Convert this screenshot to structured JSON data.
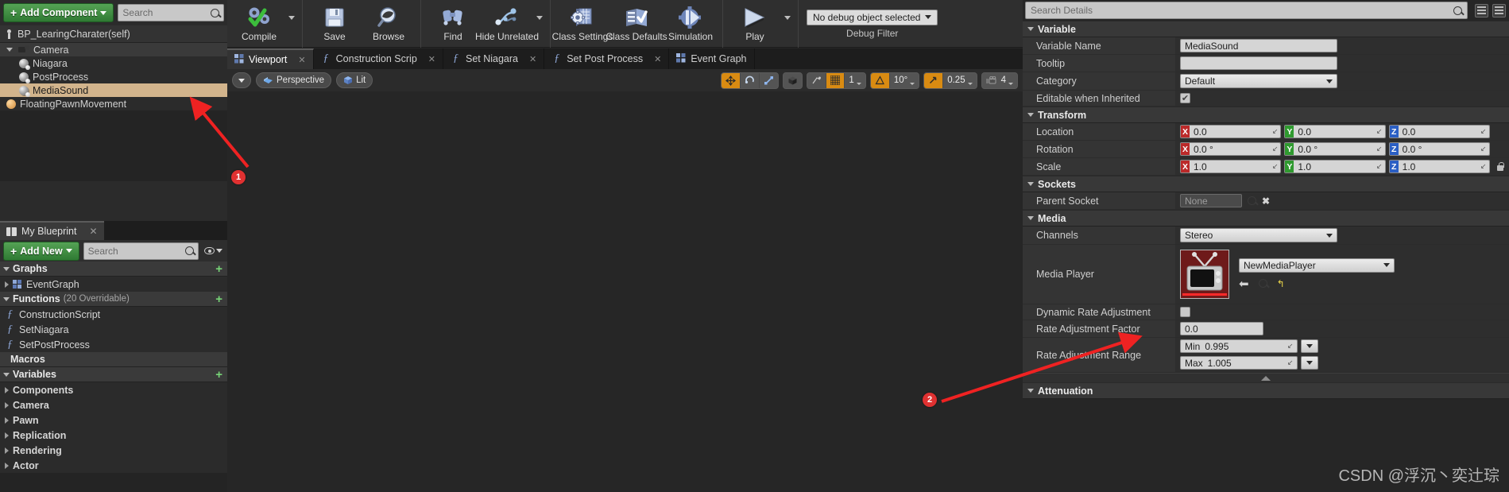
{
  "components_panel": {
    "add_component_label": "Add Component",
    "search_placeholder": "Search",
    "root_label": "BP_LearingCharater(self)",
    "items": [
      {
        "label": "Camera",
        "indent": 0,
        "icon": "camera-icon",
        "selected": false
      },
      {
        "label": "Niagara",
        "indent": 1,
        "icon": "sphere-icon",
        "selected": false
      },
      {
        "label": "PostProcess",
        "indent": 1,
        "icon": "sphere-icon",
        "selected": false
      },
      {
        "label": "MediaSound",
        "indent": 1,
        "icon": "sphere-icon",
        "selected": true
      },
      {
        "label": "FloatingPawnMovement",
        "indent": 0,
        "icon": "movement-icon",
        "selected": false
      }
    ]
  },
  "my_blueprint": {
    "tab_label": "My Blueprint",
    "add_new_label": "Add New",
    "search_placeholder": "Search",
    "sections": [
      {
        "title": "Graphs",
        "sub": "",
        "expanded": true,
        "items": [
          {
            "label": "EventGraph",
            "icon": "graph-icon",
            "expandable": true
          }
        ]
      },
      {
        "title": "Functions",
        "sub": "(20 Overridable)",
        "expanded": true,
        "items": [
          {
            "label": "ConstructionScript",
            "icon": "function-icon",
            "expandable": false
          },
          {
            "label": "SetNiagara",
            "icon": "function-icon",
            "expandable": false
          },
          {
            "label": "SetPostProcess",
            "icon": "function-icon",
            "expandable": false
          }
        ]
      },
      {
        "title": "Macros",
        "sub": "",
        "expanded": false,
        "items": []
      },
      {
        "title": "Variables",
        "sub": "",
        "expanded": true,
        "items": [
          {
            "label": "Components",
            "icon": "",
            "expandable": true
          },
          {
            "label": "Camera",
            "icon": "",
            "expandable": true
          },
          {
            "label": "Pawn",
            "icon": "",
            "expandable": true
          },
          {
            "label": "Replication",
            "icon": "",
            "expandable": true
          },
          {
            "label": "Rendering",
            "icon": "",
            "expandable": true
          },
          {
            "label": "Actor",
            "icon": "",
            "expandable": true
          }
        ]
      }
    ]
  },
  "toolbar": {
    "buttons": [
      {
        "label": "Compile",
        "icon": "compile-icon",
        "has_dropdown": true
      },
      {
        "label": "Save",
        "icon": "save-icon",
        "has_dropdown": false
      },
      {
        "label": "Browse",
        "icon": "browse-icon",
        "has_dropdown": false
      },
      {
        "label": "Find",
        "icon": "find-icon",
        "has_dropdown": false
      },
      {
        "label": "Hide Unrelated",
        "icon": "hide-unrelated-icon",
        "has_dropdown": true
      },
      {
        "label": "Class Settings",
        "icon": "class-settings-icon",
        "has_dropdown": false
      },
      {
        "label": "Class Defaults",
        "icon": "class-defaults-icon",
        "has_dropdown": false
      },
      {
        "label": "Simulation",
        "icon": "simulation-icon",
        "has_dropdown": false
      },
      {
        "label": "Play",
        "icon": "play-icon",
        "has_dropdown": true
      }
    ],
    "debug_selected": "No debug object selected",
    "debug_filter_label": "Debug Filter"
  },
  "graph_tabs": [
    {
      "label": "Viewport",
      "icon": "viewport-icon",
      "active": true,
      "closable": true
    },
    {
      "label": "Construction Scrip",
      "icon": "function-icon",
      "active": false,
      "closable": true
    },
    {
      "label": "Set Niagara",
      "icon": "function-icon",
      "active": false,
      "closable": true
    },
    {
      "label": "Set Post Process",
      "icon": "function-icon",
      "active": false,
      "closable": true
    },
    {
      "label": "Event Graph",
      "icon": "graph-icon",
      "active": false,
      "closable": false
    }
  ],
  "viewport": {
    "perspective_label": "Perspective",
    "lit_label": "Lit",
    "grid_snap_value": "1",
    "angle_snap_value": "10°",
    "scale_snap_value": "0.25",
    "camera_speed_value": "4"
  },
  "details": {
    "search_placeholder": "Search Details",
    "categories": [
      {
        "title": "Variable",
        "rows": [
          {
            "name": "Variable Name",
            "type": "text",
            "value": "MediaSound"
          },
          {
            "name": "Tooltip",
            "type": "text",
            "value": ""
          },
          {
            "name": "Category",
            "type": "combo",
            "value": "Default"
          },
          {
            "name": "Editable when Inherited",
            "type": "checkbox",
            "value": true
          }
        ]
      },
      {
        "title": "Transform",
        "rows": [
          {
            "name": "Location",
            "type": "vector",
            "x": "0.0",
            "y": "0.0",
            "z": "0.0"
          },
          {
            "name": "Rotation",
            "type": "vector",
            "x": "0.0 °",
            "y": "0.0 °",
            "z": "0.0 °"
          },
          {
            "name": "Scale",
            "type": "vector",
            "x": "1.0",
            "y": "1.0",
            "z": "1.0"
          }
        ]
      },
      {
        "title": "Sockets",
        "rows": [
          {
            "name": "Parent Socket",
            "type": "socket",
            "value": "None"
          }
        ]
      },
      {
        "title": "Media",
        "rows": [
          {
            "name": "Channels",
            "type": "combo",
            "value": "Stereo"
          },
          {
            "name": "Media Player",
            "type": "asset",
            "value": "NewMediaPlayer"
          },
          {
            "name": "Dynamic Rate Adjustment",
            "type": "checkbox",
            "value": false
          },
          {
            "name": "Rate Adjustment Factor",
            "type": "number",
            "value": "0.0"
          },
          {
            "name": "Rate Adjustment Range",
            "type": "minmax",
            "min_label": "Min",
            "min_value": "0.995",
            "max_label": "Max",
            "max_value": "1.005"
          }
        ]
      },
      {
        "title": "Attenuation",
        "rows": []
      }
    ]
  },
  "annotations": [
    {
      "id": "1",
      "label": "1"
    },
    {
      "id": "2",
      "label": "2"
    }
  ],
  "watermark": "CSDN @浮沉丶奕辻琮",
  "colors": {
    "accent_orange": "#d98b12",
    "selection_tan": "#d2b48c",
    "annotation_red": "#e03131",
    "green_button": "#3f8c3f"
  }
}
